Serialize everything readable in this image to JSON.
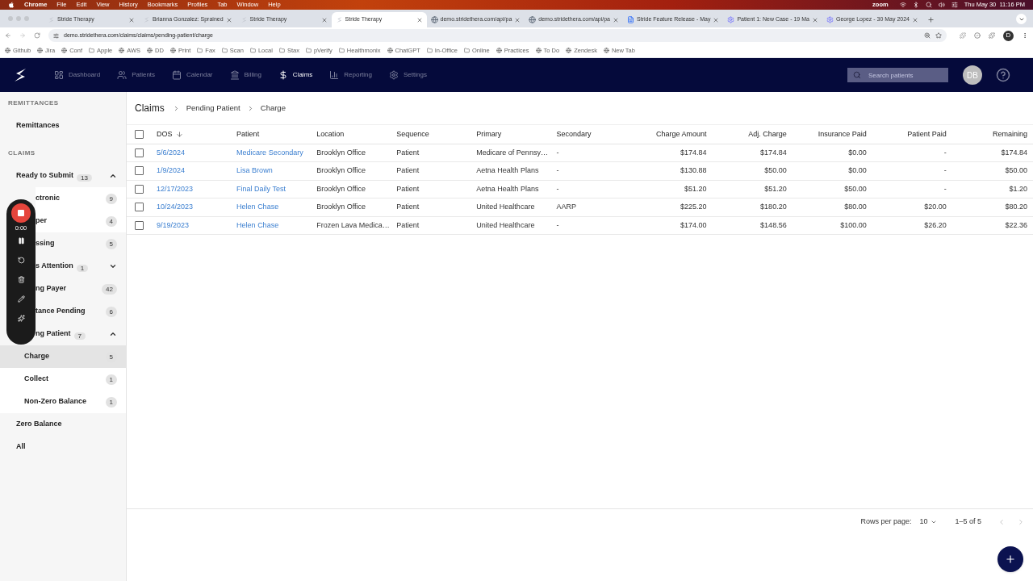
{
  "menu_bar": {
    "app": "Chrome",
    "menus": [
      "File",
      "Edit",
      "View",
      "History",
      "Bookmarks",
      "Profiles",
      "Tab",
      "Window",
      "Help"
    ],
    "status_text": "zoom",
    "clock": "Thu May 30  11:16 PM"
  },
  "browser": {
    "tabs": [
      {
        "title": "Stride Therapy",
        "kind": "app",
        "selected": false
      },
      {
        "title": "Brianna Gonzalez: Sprained",
        "kind": "app",
        "selected": false
      },
      {
        "title": "Stride Therapy",
        "kind": "app",
        "selected": false
      },
      {
        "title": "Stride Therapy",
        "kind": "app",
        "selected": true
      },
      {
        "title": "demo.stridethera.com/api/pa",
        "kind": "globe",
        "selected": false
      },
      {
        "title": "demo.stridethera.com/api/pa",
        "kind": "globe",
        "selected": false
      },
      {
        "title": "Stride Feature Release - May",
        "kind": "doc",
        "selected": false
      },
      {
        "title": "Patient 1: New Case - 19 Ma",
        "kind": "gear",
        "selected": false
      },
      {
        "title": "George Lopez - 30 May 2024",
        "kind": "gear",
        "selected": false
      }
    ],
    "url": "demo.stridethera.com/claims/claims/pending-patient/charge",
    "profile": "D",
    "bookmarks": [
      {
        "label": "Github",
        "kind": "site"
      },
      {
        "label": "Jira",
        "kind": "site"
      },
      {
        "label": "Conf",
        "kind": "site"
      },
      {
        "label": "Apple",
        "kind": "folder"
      },
      {
        "label": "AWS",
        "kind": "site"
      },
      {
        "label": "DD",
        "kind": "site"
      },
      {
        "label": "Print",
        "kind": "site"
      },
      {
        "label": "Fax",
        "kind": "folder"
      },
      {
        "label": "Scan",
        "kind": "folder"
      },
      {
        "label": "Local",
        "kind": "folder"
      },
      {
        "label": "Stax",
        "kind": "folder"
      },
      {
        "label": "pVerify",
        "kind": "folder"
      },
      {
        "label": "Healthmonix",
        "kind": "folder"
      },
      {
        "label": "ChatGPT",
        "kind": "site"
      },
      {
        "label": "In-Office",
        "kind": "folder"
      },
      {
        "label": "Online",
        "kind": "folder"
      },
      {
        "label": "Practices",
        "kind": "site"
      },
      {
        "label": "To Do",
        "kind": "site"
      },
      {
        "label": "Zendesk",
        "kind": "site"
      },
      {
        "label": "New Tab",
        "kind": "site"
      }
    ]
  },
  "nav": {
    "items": [
      {
        "label": "Dashboard",
        "selected": false
      },
      {
        "label": "Patients",
        "selected": false
      },
      {
        "label": "Calendar",
        "selected": false
      },
      {
        "label": "Billing",
        "selected": false
      },
      {
        "label": "Claims",
        "selected": true
      },
      {
        "label": "Reporting",
        "selected": false
      },
      {
        "label": "Settings",
        "selected": false
      }
    ],
    "search": {
      "placeholder": "Search patients"
    },
    "avatar": "DB"
  },
  "sidebar": {
    "sections": [
      {
        "heading": "REMITTANCES",
        "items": [
          {
            "label": "Remittances",
            "selected": false,
            "covered": false
          }
        ]
      },
      {
        "heading": "CLAIMS",
        "items": [
          {
            "label": "Ready to Submit",
            "count": "13",
            "expanded": true,
            "selected": false,
            "covered": false,
            "children": [
              {
                "label": "ctronic",
                "count": "9",
                "selected": false,
                "covered": true
              },
              {
                "label": "per",
                "count": "4",
                "selected": false,
                "covered": true
              }
            ]
          },
          {
            "label": "ssing",
            "count": "5",
            "selected": false,
            "covered": true
          },
          {
            "label": "s Attention",
            "count": "1",
            "expanded": false,
            "selected": false,
            "covered": true
          },
          {
            "label": "ng Payer",
            "count": "42",
            "selected": false,
            "covered": true
          },
          {
            "label": "tance Pending",
            "count": "6",
            "selected": false,
            "covered": true
          },
          {
            "label": "ng Patient",
            "count": "7",
            "expanded": true,
            "selected": false,
            "covered": true,
            "children": [
              {
                "label": "Charge",
                "count": "5",
                "selected": true,
                "covered": false
              },
              {
                "label": "Collect",
                "count": "1",
                "selected": false,
                "covered": false
              },
              {
                "label": "Non-Zero Balance",
                "count": "1",
                "selected": false,
                "covered": false
              }
            ]
          },
          {
            "label": "Zero Balance",
            "selected": false,
            "covered": false
          },
          {
            "label": "All",
            "selected": false,
            "covered": false
          }
        ]
      }
    ]
  },
  "recorder": {
    "time": "0:00"
  },
  "breadcrumbs": [
    "Claims",
    "Pending Patient",
    "Charge"
  ],
  "table": {
    "columns": [
      {
        "label": "DOS",
        "kind": "link",
        "sorted": true
      },
      {
        "label": "Patient",
        "kind": "link",
        "sorted": false
      },
      {
        "label": "Location",
        "kind": "text",
        "sorted": false
      },
      {
        "label": "Sequence",
        "kind": "text",
        "sorted": false
      },
      {
        "label": "Primary",
        "kind": "text",
        "sorted": false
      },
      {
        "label": "Secondary",
        "kind": "text",
        "sorted": false
      },
      {
        "label": "Charge Amount",
        "kind": "money",
        "sorted": false
      },
      {
        "label": "Adj. Charge",
        "kind": "money",
        "sorted": false
      },
      {
        "label": "Insurance Paid",
        "kind": "money",
        "sorted": false
      },
      {
        "label": "Patient Paid",
        "kind": "money",
        "sorted": false
      },
      {
        "label": "Remaining",
        "kind": "money",
        "sorted": false
      }
    ],
    "rows": [
      {
        "checked": false,
        "cells": [
          "5/6/2024",
          "Medicare Secondary",
          "Brooklyn Office",
          "Patient",
          "Medicare of Pennsy…",
          "-",
          "$174.84",
          "$174.84",
          "$0.00",
          "-",
          "$174.84"
        ]
      },
      {
        "checked": false,
        "cells": [
          "1/9/2024",
          "Lisa Brown",
          "Brooklyn Office",
          "Patient",
          "Aetna Health Plans",
          "-",
          "$130.88",
          "$50.00",
          "$0.00",
          "-",
          "$50.00"
        ]
      },
      {
        "checked": false,
        "cells": [
          "12/17/2023",
          "Final Daily Test",
          "Brooklyn Office",
          "Patient",
          "Aetna Health Plans",
          "-",
          "$51.20",
          "$51.20",
          "$50.00",
          "-",
          "$1.20"
        ]
      },
      {
        "checked": false,
        "cells": [
          "10/24/2023",
          "Helen Chase",
          "Brooklyn Office",
          "Patient",
          "United Healthcare",
          "AARP",
          "$225.20",
          "$180.20",
          "$80.00",
          "$20.00",
          "$80.20"
        ]
      },
      {
        "checked": false,
        "cells": [
          "9/19/2023",
          "Helen Chase",
          "Frozen Lava Medica…",
          "Patient",
          "United Healthcare",
          "-",
          "$174.00",
          "$148.56",
          "$100.00",
          "$26.20",
          "$22.36"
        ]
      }
    ],
    "all_checked": false
  },
  "pagination": {
    "label": "Rows per page:",
    "value": "10",
    "range": "1–5 of 5"
  }
}
